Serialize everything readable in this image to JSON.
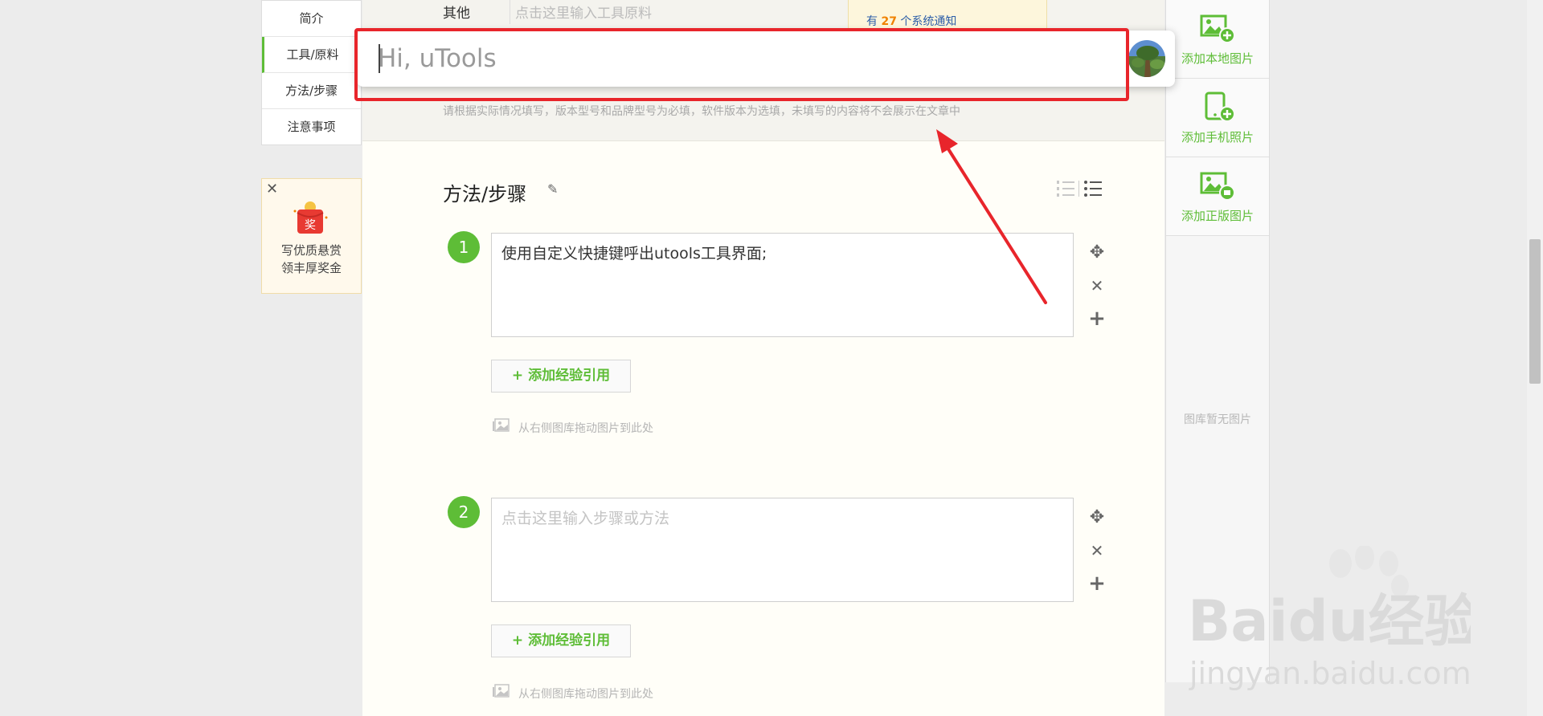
{
  "left_nav": {
    "items": [
      {
        "label": "简介"
      },
      {
        "label": "工具/原料"
      },
      {
        "label": "方法/步骤"
      },
      {
        "label": "注意事项"
      }
    ]
  },
  "reward": {
    "close": "✕",
    "icon_text": "奖",
    "line1": "写优质悬赏",
    "line2": "领丰厚奖金"
  },
  "tools": {
    "other_label": "其他",
    "input_placeholder": "点击这里输入工具原料",
    "notice_prefix": "有",
    "notice_count": "27",
    "notice_suffix": "个系统通知",
    "hint": "请根据实际情况填写，版本型号和品牌型号为必填，软件版本为选填，未填写的内容将不会展示在文章中"
  },
  "section": {
    "title": "方法/步骤",
    "pencil": "✎"
  },
  "steps": [
    {
      "number": "1",
      "text": "使用自定义快捷键呼出utools工具界面;",
      "add_ref": "+ 添加经验引用",
      "drag_hint": "从右侧图库拖动图片到此处"
    },
    {
      "number": "2",
      "placeholder": "点击这里输入步骤或方法",
      "add_ref": "+ 添加经验引用",
      "drag_hint": "从右侧图库拖动图片到此处"
    }
  ],
  "controls": {
    "move": "✥",
    "remove": "✕",
    "add": "+"
  },
  "right_panel": {
    "buttons": [
      {
        "label": "添加本地图片",
        "icon": "local-image-add-icon"
      },
      {
        "label": "添加手机照片",
        "icon": "phone-photo-add-icon"
      },
      {
        "label": "添加正版图片",
        "icon": "licensed-image-add-icon"
      }
    ],
    "empty_text": "图库暂无图片"
  },
  "utools": {
    "placeholder": "Hi, uTools"
  },
  "watermark": {
    "brand": "Baidu经验",
    "url": "jingyan.baidu.com"
  },
  "colors": {
    "accent_green": "#5ebd37",
    "highlight_red": "#e8252b",
    "notice_orange": "#f08200"
  }
}
